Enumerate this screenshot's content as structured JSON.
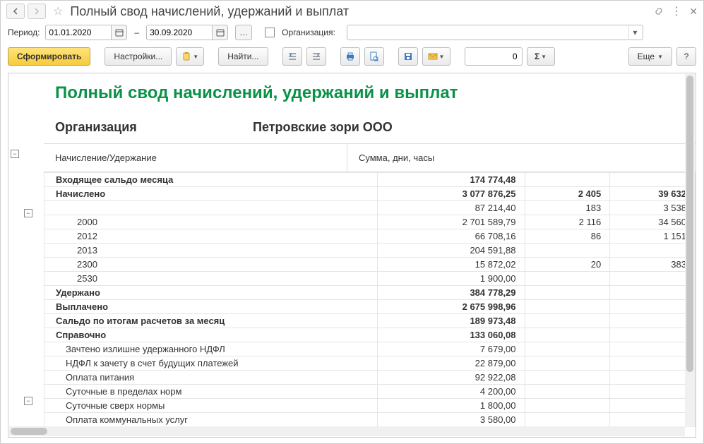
{
  "title": "Полный свод начислений, удержаний и выплат",
  "period": {
    "label": "Период:",
    "from": "01.01.2020",
    "to": "30.09.2020",
    "dash": "–"
  },
  "org": {
    "checkbox_label": "Организация:"
  },
  "toolbar": {
    "generate": "Сформировать",
    "settings": "Настройки...",
    "find": "Найти...",
    "number": "0",
    "more": "Еще",
    "help": "?"
  },
  "report": {
    "title": "Полный свод начислений, удержаний и выплат",
    "org_label": "Организация",
    "org_value": "Петровские зори ООО",
    "header_name": "Начисление/Удержание",
    "header_amounts": "Сумма, дни, часы"
  },
  "rows": [
    {
      "name": "Входящее сальдо месяца",
      "c1": "174 774,48",
      "c2": "",
      "c3": "",
      "bold": true
    },
    {
      "name": "Начислено",
      "c1": "3 077 876,25",
      "c2": "2 405",
      "c3": "39 632",
      "bold": true
    },
    {
      "name": "",
      "c1": "87 214,40",
      "c2": "183",
      "c3": "3 538",
      "indent": 1
    },
    {
      "name": "2000",
      "c1": "2 701 589,79",
      "c2": "2 116",
      "c3": "34 560",
      "indent": 1
    },
    {
      "name": "2012",
      "c1": "66 708,16",
      "c2": "86",
      "c3": "1 151",
      "indent": 1
    },
    {
      "name": "2013",
      "c1": "204 591,88",
      "c2": "",
      "c3": "",
      "indent": 1
    },
    {
      "name": "2300",
      "c1": "15 872,02",
      "c2": "20",
      "c3": "383",
      "indent": 1
    },
    {
      "name": "2530",
      "c1": "1 900,00",
      "c2": "",
      "c3": "",
      "indent": 1
    },
    {
      "name": "Удержано",
      "c1": "384 778,29",
      "c2": "",
      "c3": "",
      "bold": true
    },
    {
      "name": "Выплачено",
      "c1": "2 675 998,96",
      "c2": "",
      "c3": "",
      "bold": true
    },
    {
      "name": "Сальдо по итогам расчетов за месяц",
      "c1": "189 973,48",
      "c2": "",
      "c3": "",
      "bold": true
    },
    {
      "name": "Справочно",
      "c1": "133 060,08",
      "c2": "",
      "c3": "",
      "bold": true
    },
    {
      "name": "Зачтено излишне удержанного НДФЛ",
      "c1": "7 679,00",
      "c2": "",
      "c3": "",
      "indent": 0.5
    },
    {
      "name": "НДФЛ к зачету в счет будущих платежей",
      "c1": "22 879,00",
      "c2": "",
      "c3": "",
      "indent": 0.5
    },
    {
      "name": "Оплата питания",
      "c1": "92 922,08",
      "c2": "",
      "c3": "",
      "indent": 0.5
    },
    {
      "name": "Суточные в пределах норм",
      "c1": "4 200,00",
      "c2": "",
      "c3": "",
      "indent": 0.5
    },
    {
      "name": "Суточные сверх нормы",
      "c1": "1 800,00",
      "c2": "",
      "c3": "",
      "indent": 0.5
    },
    {
      "name": "Оплата коммунальных услуг",
      "c1": "3 580,00",
      "c2": "",
      "c3": "",
      "indent": 0.5
    }
  ]
}
